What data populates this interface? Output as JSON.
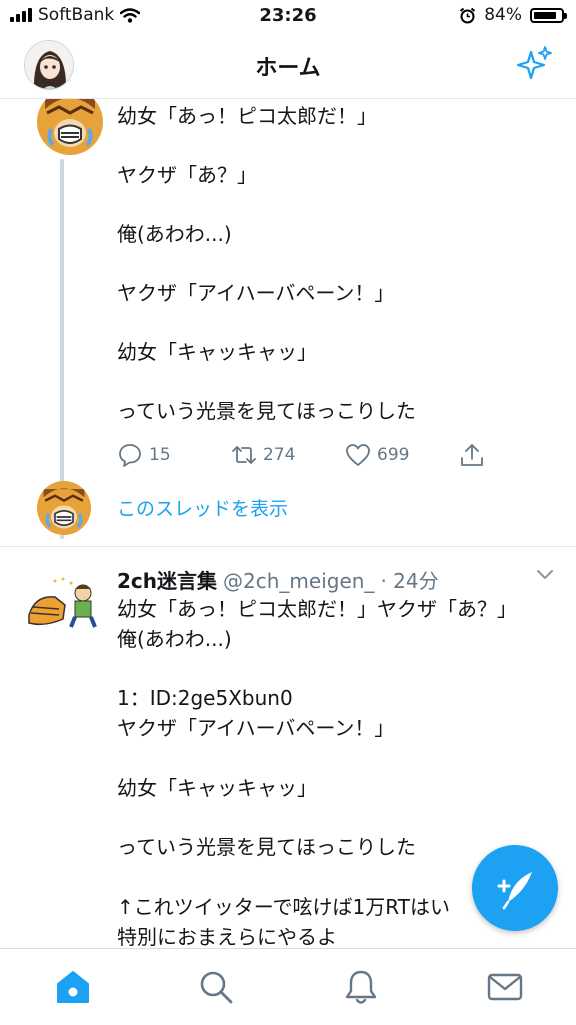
{
  "status_bar": {
    "carrier": "SoftBank",
    "time": "23:26",
    "battery": "84%"
  },
  "header": {
    "title": "ホーム"
  },
  "tweet1": {
    "text": "幼女「あっ！ピコ太郎だ！」\n\nヤクザ「あ？」\n\n俺(あわわ...)\n\nヤクザ「アイハーバペーン！」\n\n幼女「キャッキャッ」\n\nっていう光景を見てほっこりした",
    "replies": "15",
    "retweets": "274",
    "likes": "699"
  },
  "thread": {
    "show_label": "このスレッドを表示"
  },
  "tweet2": {
    "name": "2ch迷言集",
    "handle": "@2ch_meigen_",
    "time": "· 24分",
    "text": "幼女「あっ！ピコ太郎だ！」ヤクザ「あ？」\n俺(あわわ...)\n\n1：ID:2ge5Xbun0\nヤクザ「アイハーバペーン！」\n\n幼女「キャッキャッ」\n\nっていう光景を見てほっこりした\n\n↑これツイッターで呟けば1万RTはい\n特別におまえらにやるよ"
  },
  "colors": {
    "accent": "#1da1f2",
    "text": "#14171a",
    "muted": "#657786",
    "border": "#e1e8ed"
  },
  "icons": [
    "wifi-icon",
    "alarm-icon",
    "battery-icon",
    "sparkle-icon",
    "reply-icon",
    "retweet-icon",
    "like-icon",
    "share-icon",
    "caret-down-icon",
    "compose-icon",
    "home-icon",
    "search-icon",
    "notifications-icon",
    "messages-icon"
  ]
}
